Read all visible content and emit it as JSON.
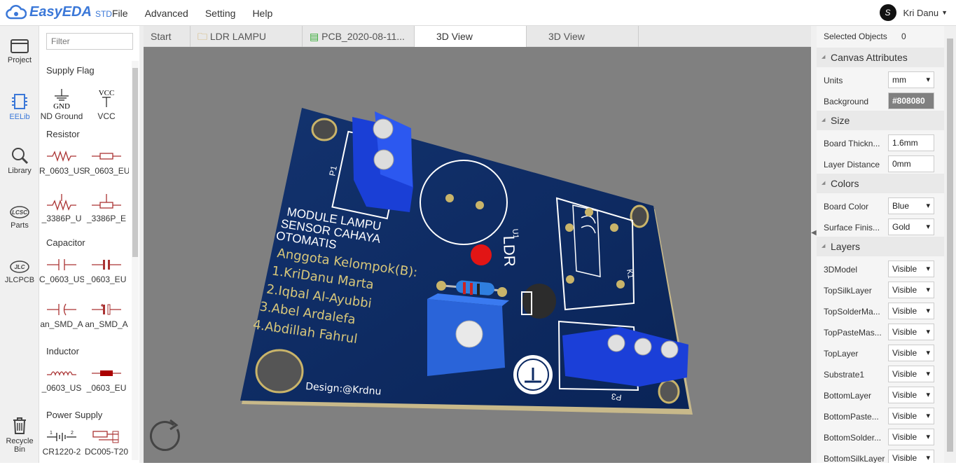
{
  "app": {
    "logo": "EasyEDA",
    "edition": "STD"
  },
  "menu": [
    "File",
    "Advanced",
    "Setting",
    "Help"
  ],
  "user": {
    "initial": "S",
    "name": "Kri Danu"
  },
  "leftnav": [
    "Project",
    "EELib",
    "Library",
    "Parts",
    "JLCPCB",
    "Recycle Bin"
  ],
  "library": {
    "filter_placeholder": "Filter",
    "categories": [
      "Supply Flag",
      "Resistor",
      "Capacitor",
      "Inductor",
      "Power Supply"
    ],
    "items": [
      "ND Ground",
      "VCC",
      "R_0603_US",
      "R_0603_EU",
      "_3386P_U",
      "_3386P_E",
      "C_0603_US",
      "_0603_EU",
      "an_SMD_A",
      "an_SMD_A",
      "_0603_US",
      "_0603_EU",
      "CR1220-2",
      "DC005-T20"
    ],
    "gnd_symbol_text": "GND",
    "vcc_symbol_text": "VCC"
  },
  "tabs": [
    "Start",
    "LDR LAMPU",
    "PCB_2020-08-11...",
    "3D View",
    "3D View"
  ],
  "pcb": {
    "silk_title": [
      "MODULE LAMPU",
      "SENSOR CAHAYA",
      "OTOMATIS"
    ],
    "group_label": "Anggota Kelompok(B):",
    "members": [
      "1.KriDanu Marta",
      "2.Iqbal Al-Ayubbi",
      "3.Abel Ardalefa",
      "4.Abdillah Fahrul"
    ],
    "design": "Design:@Krdnu",
    "refs": {
      "p1": "P1",
      "u1": "U1",
      "ldr": "LDR",
      "k1": "K1",
      "p3": "P3"
    },
    "board_color": "#0c2a63"
  },
  "properties": {
    "selected_label": "Selected Objects",
    "selected_count": "0",
    "sections": {
      "canvas": "Canvas Attributes",
      "size": "Size",
      "colors": "Colors",
      "layers": "Layers"
    },
    "units": {
      "label": "Units",
      "value": "mm"
    },
    "background": {
      "label": "Background",
      "value": "#808080"
    },
    "board_thickness": {
      "label": "Board Thickn...",
      "value": "1.6mm"
    },
    "layer_distance": {
      "label": "Layer Distance",
      "value": "0mm"
    },
    "board_color": {
      "label": "Board Color",
      "value": "Blue"
    },
    "surface_finish": {
      "label": "Surface Finis...",
      "value": "Gold"
    },
    "layers": [
      {
        "label": "3DModel",
        "value": "Visible"
      },
      {
        "label": "TopSilkLayer",
        "value": "Visible"
      },
      {
        "label": "TopSolderMa...",
        "value": "Visible"
      },
      {
        "label": "TopPasteMas...",
        "value": "Visible"
      },
      {
        "label": "TopLayer",
        "value": "Visible"
      },
      {
        "label": "Substrate1",
        "value": "Visible"
      },
      {
        "label": "BottomLayer",
        "value": "Visible"
      },
      {
        "label": "BottomPaste...",
        "value": "Visible"
      },
      {
        "label": "BottomSolder...",
        "value": "Visible"
      },
      {
        "label": "BottomSilkLayer",
        "value": "Visible"
      }
    ]
  }
}
